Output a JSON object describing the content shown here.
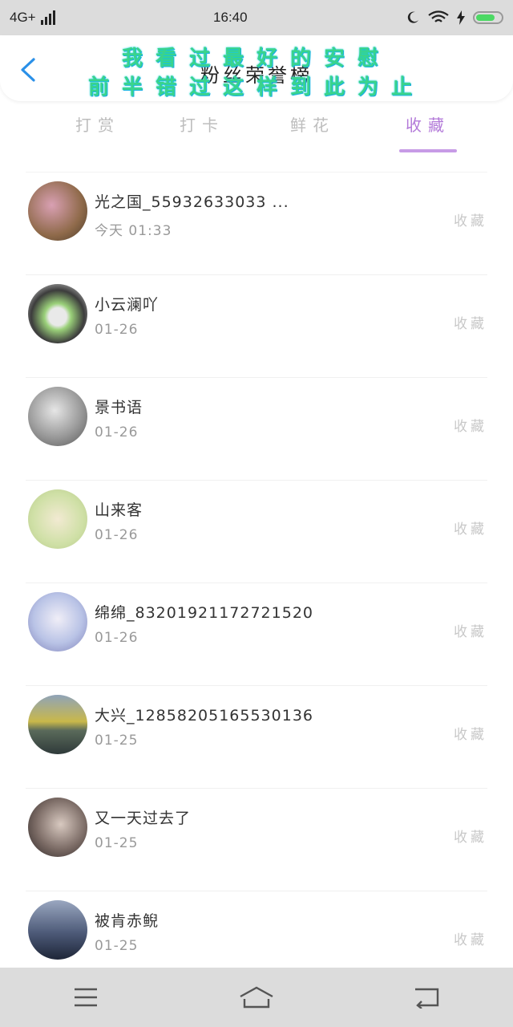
{
  "status": {
    "network": "4G+",
    "time": "16:40",
    "icons": [
      "signal-icon",
      "moon-icon",
      "wifi-icon",
      "charging-icon",
      "battery-icon"
    ],
    "battery_level": 0.75
  },
  "header": {
    "title": "粉丝荣誉榜",
    "overlay_line1": "我看过最好的安慰",
    "overlay_line2": "前半错过这样到此为止",
    "back_icon": "chevron-left-icon"
  },
  "tabs": [
    {
      "label": "打赏",
      "active": false
    },
    {
      "label": "打卡",
      "active": false
    },
    {
      "label": "鲜花",
      "active": false
    },
    {
      "label": "收藏",
      "active": true
    }
  ],
  "accent": "#b37ad9",
  "list": [
    {
      "name": "光之国_55932633033 ...",
      "time": "今天 01:33",
      "action": "收藏",
      "avatar_color": "#8f6a4a"
    },
    {
      "name": "小云澜吖",
      "time": "01-26",
      "action": "收藏",
      "avatar_color": "#3c3c3c"
    },
    {
      "name": "景书语",
      "time": "01-26",
      "action": "收藏",
      "avatar_color": "#9a9a9a"
    },
    {
      "name": "山来客",
      "time": "01-26",
      "action": "收藏",
      "avatar_color": "#cfe0a6"
    },
    {
      "name": "绵绵_83201921172721520",
      "time": "01-26",
      "action": "收藏",
      "avatar_color": "#b9c3e6"
    },
    {
      "name": "大兴_12858205165530136",
      "time": "01-25",
      "action": "收藏",
      "avatar_color": "#5a6a5a"
    },
    {
      "name": "又一天过去了",
      "time": "01-25",
      "action": "收藏",
      "avatar_color": "#4a3f3c"
    },
    {
      "name": "被肯赤鲵",
      "time": "01-25",
      "action": "收藏",
      "avatar_color": "#4d5a78"
    }
  ],
  "bottom_nav": [
    "menu-icon",
    "home-icon",
    "back-arrow-icon"
  ]
}
